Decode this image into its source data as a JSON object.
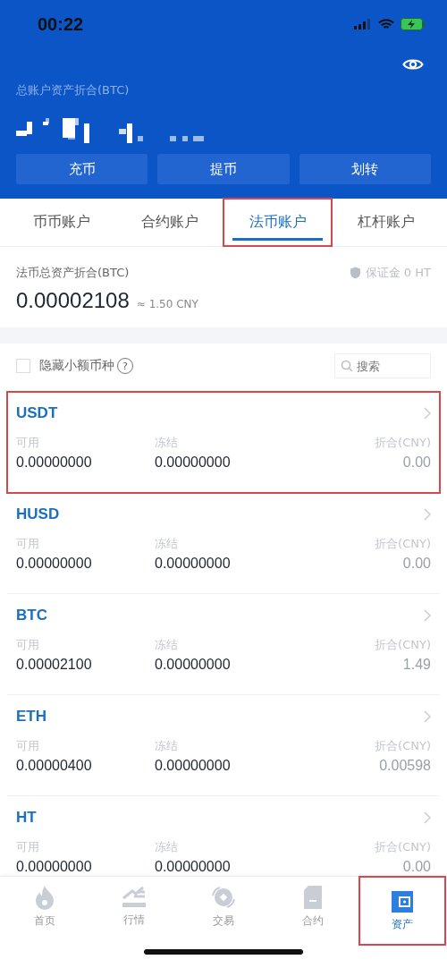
{
  "status_bar": {
    "time": "00:22"
  },
  "header": {
    "title": "总账户资产折合(BTC)",
    "actions": [
      "充币",
      "提币",
      "划转"
    ]
  },
  "tabs": [
    {
      "label": "币币账户",
      "selected": false,
      "highlighted": false
    },
    {
      "label": "合约账户",
      "selected": false,
      "highlighted": false
    },
    {
      "label": "法币账户",
      "selected": true,
      "highlighted": true
    },
    {
      "label": "杠杆账户",
      "selected": false,
      "highlighted": false
    }
  ],
  "summary": {
    "label": "法币总资产折合(BTC)",
    "deposit": "保证金 0 HT",
    "value": "0.00002108",
    "approx": "≈ 1.50 CNY"
  },
  "filter": {
    "label": "隐藏小额币种",
    "checked": false,
    "help": "?",
    "search_placeholder": "搜索"
  },
  "coins": [
    {
      "name": "USDT",
      "highlighted": true,
      "available_label": "可用",
      "available": "0.00000000",
      "frozen_label": "冻结",
      "frozen": "0.00000000",
      "value_label": "折合(CNY)",
      "value": "0.00"
    },
    {
      "name": "HUSD",
      "highlighted": false,
      "available_label": "可用",
      "available": "0.00000000",
      "frozen_label": "冻结",
      "frozen": "0.00000000",
      "value_label": "折合(CNY)",
      "value": "0.00"
    },
    {
      "name": "BTC",
      "highlighted": false,
      "available_label": "可用",
      "available": "0.00002100",
      "frozen_label": "冻结",
      "frozen": "0.00000000",
      "value_label": "折合(CNY)",
      "value": "1.49"
    },
    {
      "name": "ETH",
      "highlighted": false,
      "available_label": "可用",
      "available": "0.00000400",
      "frozen_label": "冻结",
      "frozen": "0.00000000",
      "value_label": "折合(CNY)",
      "value": "0.00598"
    },
    {
      "name": "HT",
      "highlighted": false,
      "available_label": "可用",
      "available": "0.00000000",
      "frozen_label": "冻结",
      "frozen": "0.00000000",
      "value_label": "折合(CNY)",
      "value": "0.00"
    }
  ],
  "nav": [
    {
      "label": "首页",
      "kind": "home",
      "selected": false,
      "highlighted": false
    },
    {
      "label": "行情",
      "kind": "market",
      "selected": false,
      "highlighted": false
    },
    {
      "label": "交易",
      "kind": "trade",
      "selected": false,
      "highlighted": false
    },
    {
      "label": "合约",
      "kind": "contract",
      "selected": false,
      "highlighted": false
    },
    {
      "label": "资产",
      "kind": "assets",
      "selected": true,
      "highlighted": true
    }
  ]
}
